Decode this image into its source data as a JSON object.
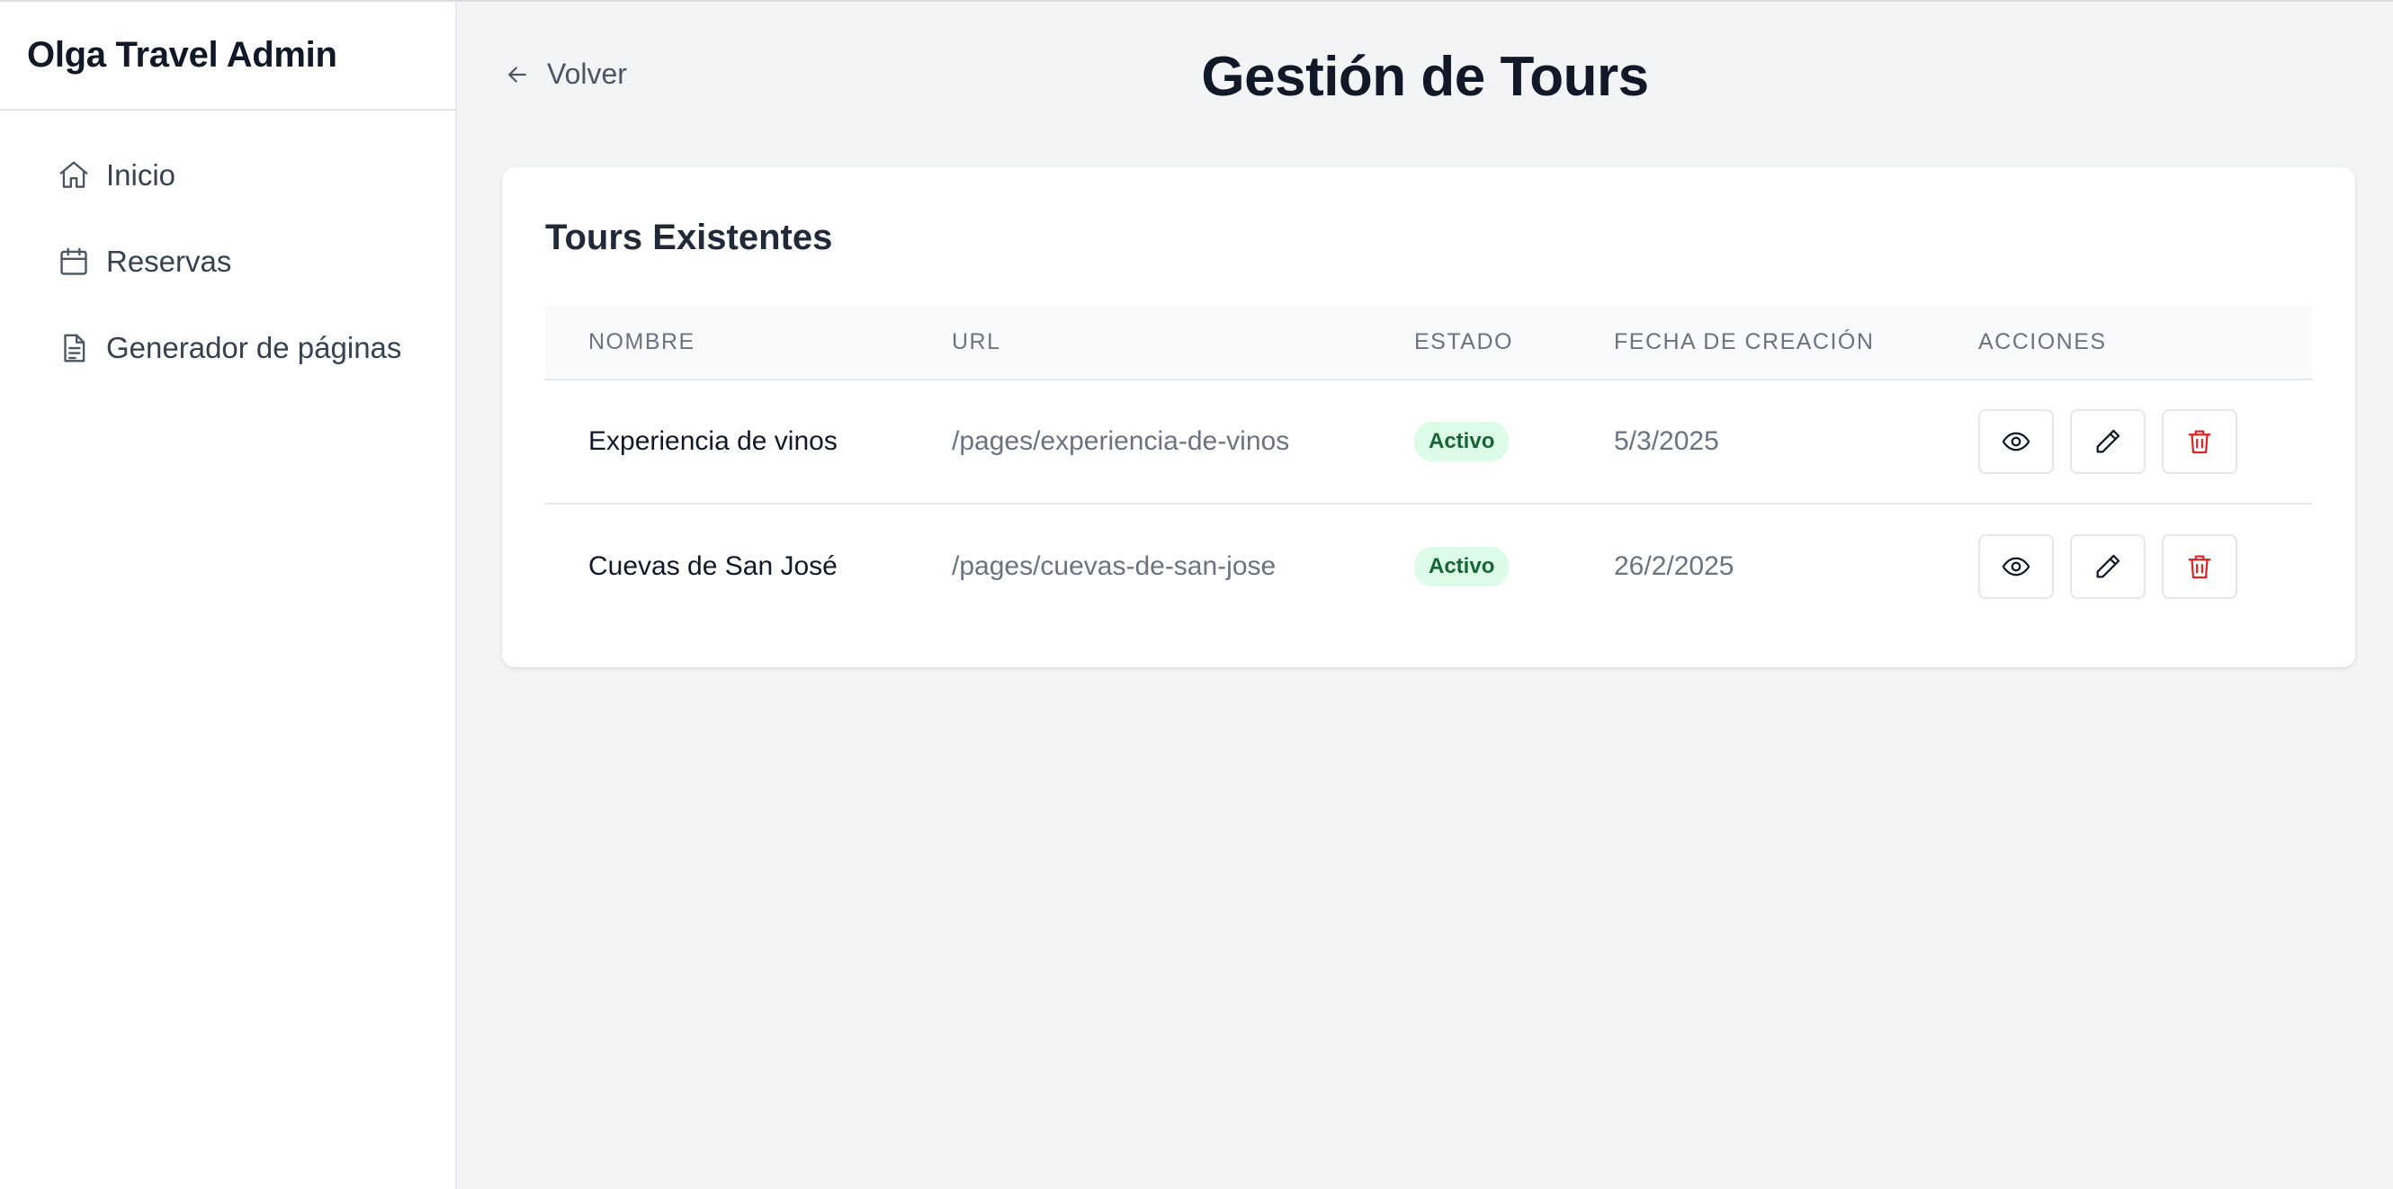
{
  "brand": "Olga Travel Admin",
  "sidebar": {
    "items": [
      {
        "label": "Inicio",
        "icon": "home-icon"
      },
      {
        "label": "Reservas",
        "icon": "calendar-icon"
      },
      {
        "label": "Generador de páginas",
        "icon": "document-icon"
      }
    ]
  },
  "header": {
    "back_label": "Volver",
    "title": "Gestión de Tours"
  },
  "card": {
    "title": "Tours Existentes",
    "columns": [
      "NOMBRE",
      "URL",
      "ESTADO",
      "FECHA DE CREACIÓN",
      "ACCIONES"
    ],
    "rows": [
      {
        "name": "Experiencia de vinos",
        "url": "/pages/experiencia-de-vinos",
        "status": "Activo",
        "date": "5/3/2025"
      },
      {
        "name": "Cuevas de San José",
        "url": "/pages/cuevas-de-san-jose",
        "status": "Activo",
        "date": "26/2/2025"
      }
    ]
  },
  "colors": {
    "background": "#f3f4f6",
    "badge_bg": "#dcfce7",
    "badge_text": "#166534",
    "delete": "#dc2626"
  }
}
